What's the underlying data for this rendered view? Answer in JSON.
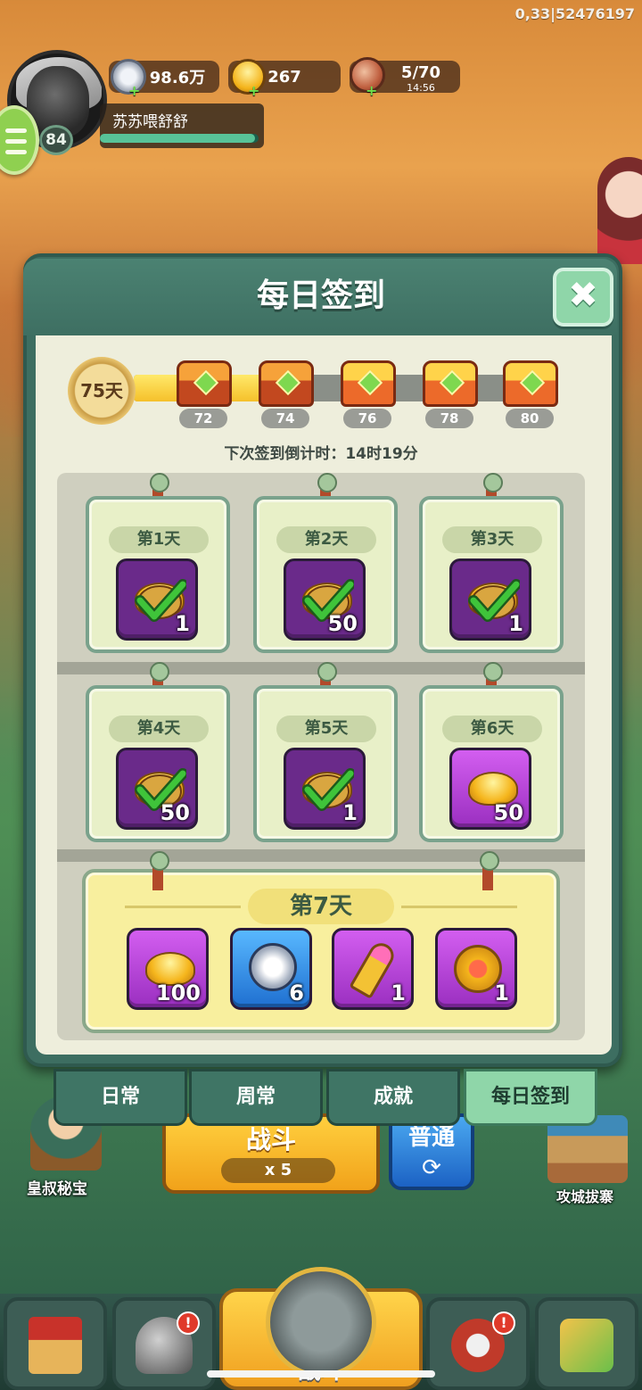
{
  "system": {
    "info": "0,33|52476197"
  },
  "player": {
    "name": "苏苏喂舒舒",
    "level": "84",
    "xp_fill": 0.98
  },
  "resources": [
    {
      "icon": "silver-coin-icon",
      "value": "98.6万"
    },
    {
      "icon": "gold-ingot-icon",
      "value": "267"
    },
    {
      "icon": "meat-stamina-icon",
      "value": "5/70",
      "timer": "14:56"
    }
  ],
  "dialog": {
    "title": "每日签到",
    "close_icon": "close-icon",
    "days_signed": "75天",
    "progress_fill": 0.31,
    "milestones": [
      {
        "label": "72",
        "icon": "treasure-chest-icon",
        "reached": true
      },
      {
        "label": "74",
        "icon": "treasure-chest-icon",
        "reached": true
      },
      {
        "label": "76",
        "icon": "treasure-chest-icon",
        "reached": false
      },
      {
        "label": "78",
        "icon": "treasure-chest-icon",
        "reached": false
      },
      {
        "label": "80",
        "icon": "treasure-chest-icon",
        "reached": false
      }
    ],
    "countdown": "下次签到倒计时：14时19分",
    "days": [
      {
        "label": "第1天",
        "icon": "gold-ingot-icon",
        "count": "1",
        "claimed": true
      },
      {
        "label": "第2天",
        "icon": "gold-ingot-icon",
        "count": "50",
        "claimed": true
      },
      {
        "label": "第3天",
        "icon": "gold-ingot-icon",
        "count": "1",
        "claimed": true
      },
      {
        "label": "第4天",
        "icon": "gold-ingot-icon",
        "count": "50",
        "claimed": true
      },
      {
        "label": "第5天",
        "icon": "gold-ingot-icon",
        "count": "1",
        "claimed": true
      },
      {
        "label": "第6天",
        "icon": "gold-ingot-icon",
        "count": "50",
        "claimed": false
      }
    ],
    "day7": {
      "label": "第7天",
      "rewards": [
        {
          "icon": "gold-ingot-icon",
          "count": "100",
          "color": "purple"
        },
        {
          "icon": "silver-coin-icon",
          "count": "6",
          "color": "blue"
        },
        {
          "icon": "key-icon",
          "count": "1",
          "color": "purple"
        },
        {
          "icon": "heart-coin-icon",
          "count": "1",
          "color": "purple"
        }
      ]
    }
  },
  "tabs": [
    {
      "label": "日常",
      "active": false
    },
    {
      "label": "周常",
      "active": false
    },
    {
      "label": "成就",
      "active": false
    },
    {
      "label": "每日签到",
      "active": true
    }
  ],
  "scene": {
    "fight_button": "战斗",
    "fight_cost": "x 5",
    "normal_button": "普通",
    "left_label": "皇叔秘宝",
    "right_label": "攻城拔寨"
  },
  "navbar": {
    "fight_label": "战斗",
    "items": [
      "castle-icon",
      "helmet-icon",
      "fight-emblem-icon",
      "stars-icon",
      "upgrade-icon"
    ]
  },
  "colors": {
    "panel": "#3d6e61",
    "active_tab": "#8fd6a9",
    "day7_bg": "#f8ef9e",
    "claimed_item": "#6a2a8a"
  }
}
